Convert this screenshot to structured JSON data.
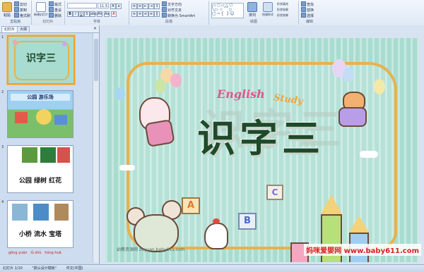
{
  "ribbon": {
    "clipboard": {
      "paste": "粘贴",
      "cut": "剪切",
      "copy": "复制",
      "format_painter": "格式刷",
      "group": "剪贴板"
    },
    "slides": {
      "new_slide": "新建幻灯片",
      "layout": "版式",
      "reset": "重设",
      "delete": "删除",
      "group": "幻灯片"
    },
    "font": {
      "font_name": "",
      "font_size": "11.5",
      "group": "字体"
    },
    "paragraph": {
      "text_direction": "文字方向",
      "align_text": "对齐文本",
      "convert_smartart": "转换为 SmartArt",
      "group": "段落"
    },
    "drawing": {
      "arrange": "排列",
      "quick_styles": "快速样式",
      "shape_fill": "形状填充",
      "shape_outline": "形状轮廓",
      "shape_effects": "形状效果",
      "group": "绘图"
    },
    "editing": {
      "find": "查找",
      "replace": "替换",
      "select": "选择",
      "group": "编辑"
    }
  },
  "left_panel": {
    "tabs": [
      "幻灯片",
      "大纲"
    ],
    "close": "×",
    "thumbnails": [
      {
        "num": "1",
        "title": "识字三"
      },
      {
        "num": "2",
        "caption": "公园  游乐场"
      },
      {
        "num": "3",
        "caption": "公园 绿树 红花"
      },
      {
        "num": "4",
        "caption": "小桥 流水 宝塔"
      }
    ],
    "bottom_labels": [
      "gōng yuán",
      "lǜ shù",
      "hóng huā"
    ]
  },
  "slide": {
    "title": "识字三",
    "english": "English",
    "study": "Study",
    "credit": "幼教资源网 zuyuan.baby611.com",
    "blocks": [
      "A",
      "B",
      "C"
    ]
  },
  "watermark": "妈咪爱婴网 www.baby611.com",
  "status": {
    "slide_info": "幻灯片 1/10",
    "theme": "\"默认设计模板\"",
    "language": "中文(中国)"
  },
  "colors": {
    "frame": "#e6b24f",
    "slide_bg": "#a8dcd0",
    "title": "#1e4a2a",
    "english": "#e0568f",
    "study": "#f2a33a",
    "watermark": "#d82020"
  }
}
